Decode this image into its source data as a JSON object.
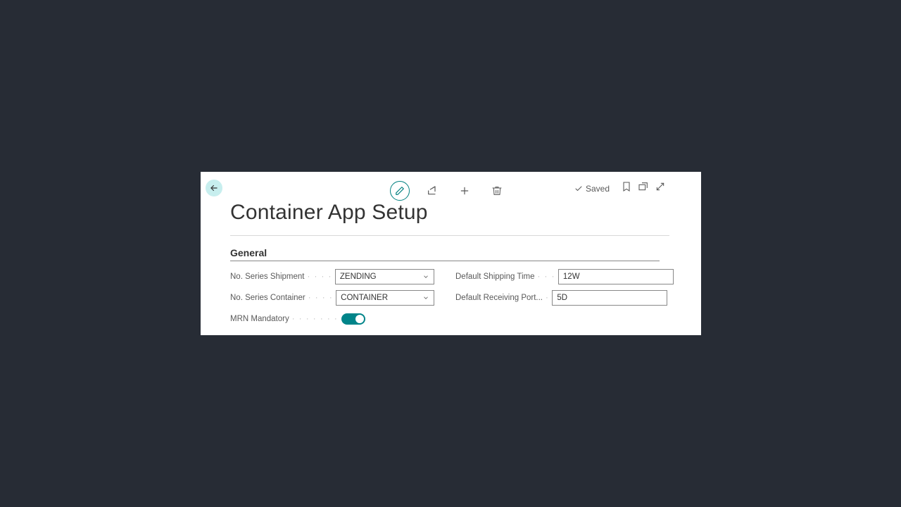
{
  "page": {
    "title": "Container App Setup"
  },
  "status": {
    "saved": "Saved"
  },
  "section": {
    "general": "General"
  },
  "fields": {
    "no_series_shipment": {
      "label": "No. Series Shipment",
      "value": "ZENDING"
    },
    "no_series_container": {
      "label": "No. Series Container",
      "value": "CONTAINER"
    },
    "mrn_mandatory": {
      "label": "MRN Mandatory",
      "value": true
    },
    "default_shipping_time": {
      "label": "Default Shipping Time",
      "value": "12W"
    },
    "default_receiving_port": {
      "label": "Default Receiving Port...",
      "value": "5D"
    }
  }
}
